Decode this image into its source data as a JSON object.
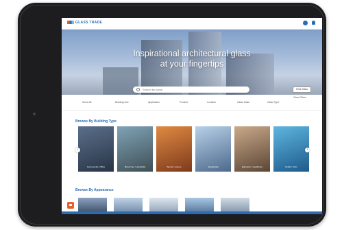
{
  "header": {
    "logo_text": "GLASS TRADE",
    "globe_icon": "globe-icon",
    "user_icon": "user-icon"
  },
  "hero": {
    "title_line1": "Inspirational architectural glass",
    "title_line2": "at your fingertips",
    "search": {
      "placeholder": "Search by name"
    },
    "find_button": "Find Glass"
  },
  "filters": {
    "items": [
      "Show All",
      "Building Use",
      "Application",
      "Product",
      "Location",
      "Glass Make",
      "Glass Type"
    ],
    "clear_label": "Clear Filters"
  },
  "sections": {
    "building_type_title": "Browse By Building Type",
    "appearance_title": "Browse By Appearance"
  },
  "building_cards": [
    {
      "label": "Commercial / Office"
    },
    {
      "label": "Mixed Use / Hospitality"
    },
    {
      "label": "Sports / Leisure"
    },
    {
      "label": "Residential"
    },
    {
      "label": "Education / Healthcare"
    },
    {
      "label": "Public / Civic"
    }
  ],
  "colors": {
    "accent": "#2a6bb3",
    "orange": "#e8612c"
  }
}
